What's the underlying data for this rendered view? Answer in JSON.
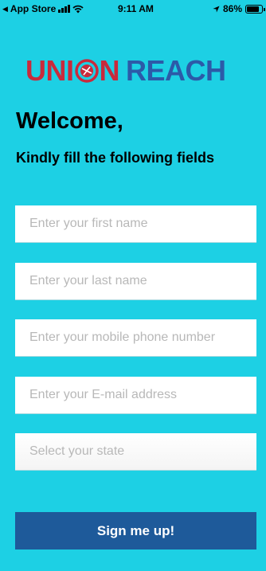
{
  "status_bar": {
    "back_app": "App Store",
    "time": "9:11 AM",
    "battery": "86%",
    "battery_level": 0.86
  },
  "logo": {
    "part1": "UNI",
    "part1_tail": "N",
    "part2": "REACH",
    "colors": {
      "red": "#c92a3c",
      "blue": "#2c5aa8"
    }
  },
  "header": {
    "title": "Welcome,",
    "subtitle": "Kindly fill the following fields"
  },
  "form": {
    "first_name_placeholder": "Enter your first name",
    "last_name_placeholder": "Enter your last name",
    "phone_placeholder": "Enter your mobile phone number",
    "email_placeholder": "Enter your E-mail address",
    "state_placeholder": "Select your state",
    "submit_label": "Sign me up!"
  },
  "theme": {
    "background": "#1dd0e4",
    "button": "#1e5a9a"
  }
}
